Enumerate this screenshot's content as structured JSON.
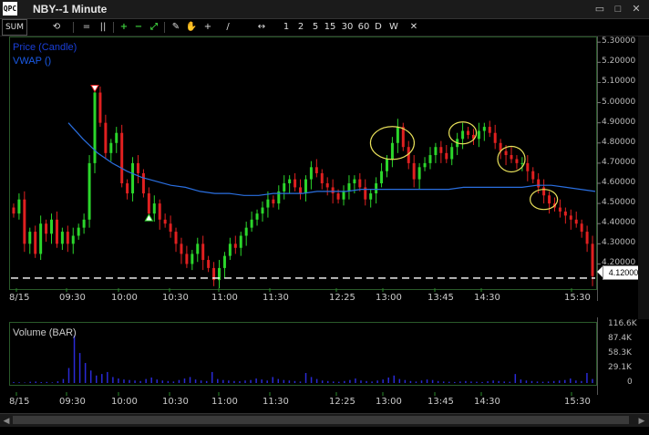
{
  "window": {
    "app_icon_text": "QPC",
    "title": "NBY--1 Minute",
    "minimize_glyph": "▭",
    "restore_glyph": "□",
    "close_glyph": "✕"
  },
  "toolbar": {
    "items": [
      {
        "name": "sum-button",
        "label": "SUM"
      },
      {
        "name": "refresh-icon",
        "label": "⟲"
      },
      {
        "name": "line-style-icon",
        "label": "="
      },
      {
        "name": "bar-style-icon",
        "label": "||"
      },
      {
        "name": "zoom-in-button",
        "label": "+"
      },
      {
        "name": "zoom-out-button",
        "label": "−"
      },
      {
        "name": "fit-icon",
        "label": "⤢"
      },
      {
        "name": "draw-icon",
        "label": "✎"
      },
      {
        "name": "hand-icon",
        "label": "✋"
      },
      {
        "name": "crosshair-icon",
        "label": "+"
      },
      {
        "name": "trendline-icon",
        "label": "/"
      },
      {
        "name": "pan-icon",
        "label": "↔"
      }
    ],
    "intervals": [
      "1",
      "2",
      "5",
      "15",
      "30",
      "60",
      "D",
      "W"
    ],
    "close_label": "✕"
  },
  "legend": {
    "price": "Price (Candle)",
    "vwap": "VWAP ()",
    "volume": "Volume (BAR)"
  },
  "colors": {
    "up": "#2bd62b",
    "down": "#e02020",
    "vwap": "#2a6fe0",
    "volume": "#2a2ad8",
    "annotation": "#e8e05a",
    "dashed_line": "#ffffff"
  },
  "last_price": "4.12000",
  "chart_data": [
    {
      "type": "candlestick",
      "title": "NBY--1 Minute",
      "ylim": [
        4.08,
        5.31
      ],
      "y_ticks": [
        "5.30000",
        "5.20000",
        "5.10000",
        "5.00000",
        "4.90000",
        "4.80000",
        "4.70000",
        "4.60000",
        "4.50000",
        "4.40000",
        "4.30000",
        "4.20000"
      ],
      "x_ticks": [
        "8/15",
        "09:30",
        "10:00",
        "10:30",
        "11:00",
        "11:30",
        "12:25",
        "13:00",
        "13:45",
        "14:30",
        "15:30"
      ],
      "series": [
        {
          "name": "Price (Candle)",
          "close": [
            4.45,
            4.52,
            4.3,
            4.36,
            4.25,
            4.4,
            4.35,
            4.42,
            4.3,
            4.36,
            4.3,
            4.34,
            4.38,
            4.42,
            4.7,
            5.05,
            4.9,
            4.75,
            4.8,
            4.85,
            4.6,
            4.55,
            4.7,
            4.65,
            4.55,
            4.45,
            4.5,
            4.42,
            4.4,
            4.36,
            4.3,
            4.25,
            4.2,
            4.25,
            4.3,
            4.22,
            4.18,
            4.12,
            4.18,
            4.24,
            4.3,
            4.28,
            4.34,
            4.38,
            4.42,
            4.45,
            4.48,
            4.52,
            4.5,
            4.56,
            4.6,
            4.62,
            4.58,
            4.55,
            4.62,
            4.68,
            4.65,
            4.6,
            4.58,
            4.55,
            4.52,
            4.56,
            4.6,
            4.62,
            4.58,
            4.52,
            4.55,
            4.6,
            4.66,
            4.72,
            4.8,
            4.88,
            4.78,
            4.7,
            4.62,
            4.68,
            4.7,
            4.74,
            4.78,
            4.75,
            4.72,
            4.78,
            4.82,
            4.86,
            4.84,
            4.82,
            4.86,
            4.88,
            4.85,
            4.8,
            4.76,
            4.74,
            4.72,
            4.7,
            4.7,
            4.66,
            4.62,
            4.58,
            4.54,
            4.5,
            4.48,
            4.46,
            4.44,
            4.42,
            4.4,
            4.36,
            4.3,
            4.14
          ]
        },
        {
          "name": "VWAP ()",
          "values": [
            4.9,
            4.82,
            4.75,
            4.7,
            4.66,
            4.63,
            4.61,
            4.59,
            4.58,
            4.56,
            4.55,
            4.55,
            4.54,
            4.54,
            4.55,
            4.55,
            4.55,
            4.56,
            4.56,
            4.56,
            4.57,
            4.57,
            4.57,
            4.57,
            4.57,
            4.57,
            4.57,
            4.58,
            4.58,
            4.58,
            4.58,
            4.58,
            4.59,
            4.59,
            4.58,
            4.57,
            4.56
          ]
        }
      ],
      "annotations": [
        {
          "type": "marker",
          "label": "sell",
          "x_index": 15
        },
        {
          "type": "marker",
          "label": "buy",
          "x_index": 25
        }
      ],
      "reference_line": 4.13
    },
    {
      "type": "bar",
      "title": "Volume (BAR)",
      "ylim": [
        0,
        116600
      ],
      "y_ticks": [
        "116.6K",
        "87.4K",
        "58.3K",
        "29.1K",
        "0"
      ],
      "x_ticks": [
        "8/15",
        "09:30",
        "10:00",
        "10:30",
        "11:00",
        "11:30",
        "12:25",
        "13:00",
        "13:45",
        "14:30",
        "15:30"
      ],
      "series": [
        {
          "name": "Volume (BAR)",
          "values": [
            2000,
            1500,
            1000,
            2500,
            3000,
            1800,
            2200,
            1200,
            3500,
            8000,
            30000,
            95000,
            60000,
            40000,
            25000,
            15000,
            18000,
            22000,
            12000,
            9000,
            7000,
            6000,
            5000,
            4000,
            8000,
            11000,
            7000,
            5000,
            4000,
            3000,
            6000,
            9000,
            12000,
            7000,
            5000,
            4000,
            22000,
            8000,
            6000,
            5000,
            4000,
            3500,
            5000,
            6000,
            9000,
            7000,
            5000,
            12000,
            8000,
            6000,
            5000,
            4000,
            3000,
            20000,
            12000,
            8000,
            5000,
            4000,
            3000,
            2500,
            4000,
            6000,
            9000,
            5000,
            4000,
            3000,
            5000,
            7000,
            11000,
            15000,
            8000,
            6000,
            4000,
            3000,
            5000,
            7000,
            6000,
            4000,
            3000,
            2500,
            2000,
            3000,
            4000,
            3000,
            2500,
            2000,
            3500,
            5000,
            4000,
            3000,
            2500,
            18000,
            7000,
            5000,
            4000,
            3000,
            2500,
            3000,
            4000,
            5000,
            6000,
            9000,
            5000,
            4000,
            20000,
            8000
          ]
        }
      ]
    }
  ]
}
